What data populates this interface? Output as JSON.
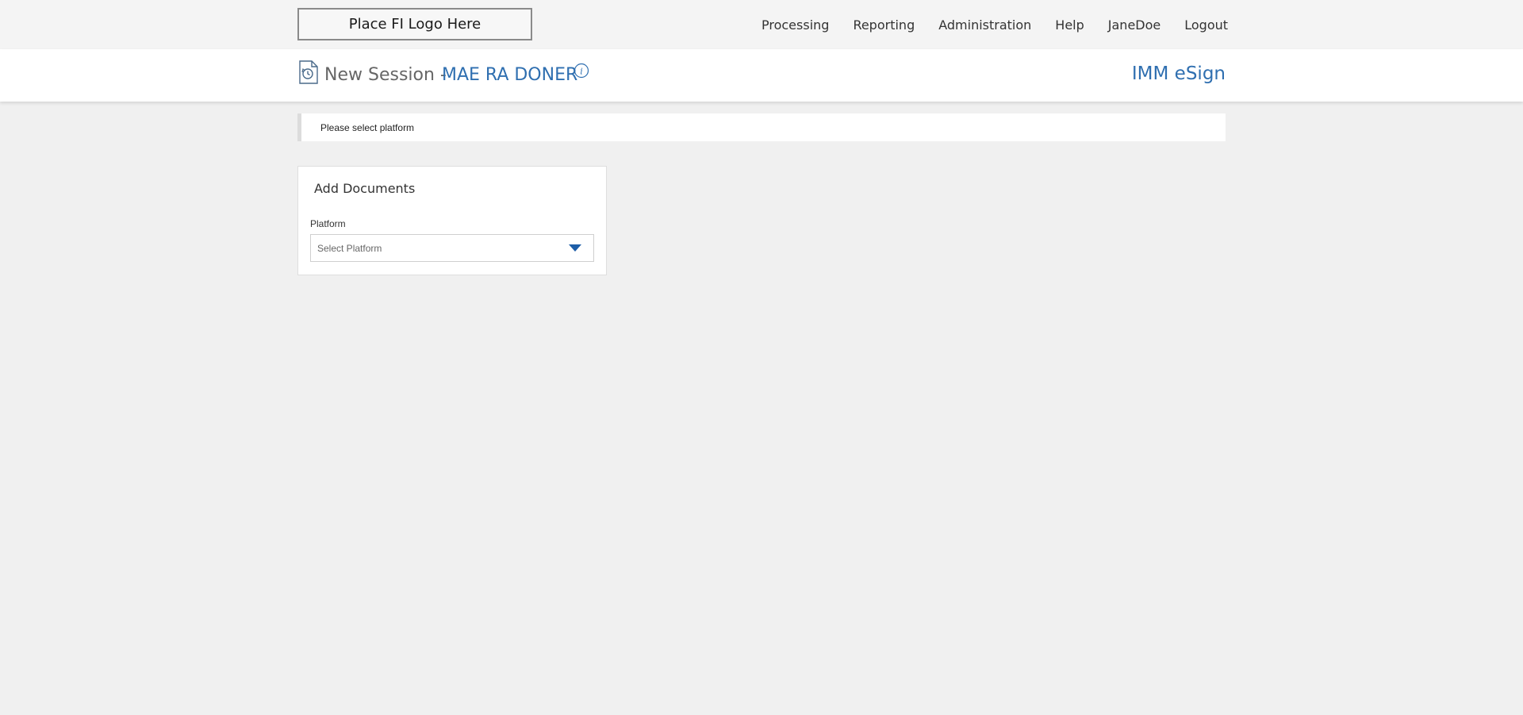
{
  "header": {
    "logo_text": "Place FI Logo Here",
    "nav": {
      "processing": "Processing",
      "reporting": "Reporting",
      "administration": "Administration",
      "help": "Help",
      "user": "JaneDoe",
      "logout": "Logout"
    }
  },
  "session": {
    "title": "New Session -",
    "name": "MAE RA DONER",
    "icon": "document-history-icon",
    "info_icon": "info-icon",
    "app_name": "IMM eSign"
  },
  "message": {
    "text": "Please select platform"
  },
  "add_documents": {
    "title": "Add Documents",
    "platform_label": "Platform",
    "platform_placeholder": "Select Platform"
  },
  "colors": {
    "accent": "#2f6fb0",
    "chevron": "#1e5ea8",
    "background": "#f0f0f0"
  }
}
